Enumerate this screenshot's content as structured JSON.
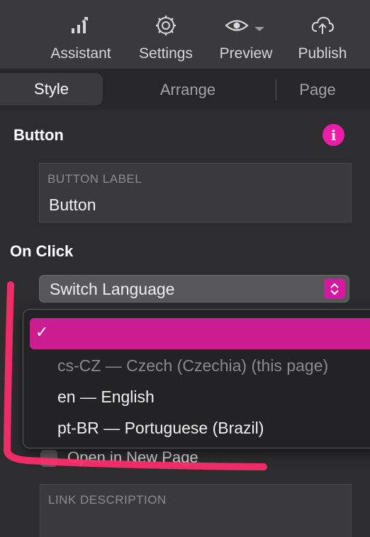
{
  "toolbar": {
    "assistant": {
      "label": "Assistant",
      "icon": "chart-bars-icon"
    },
    "settings": {
      "label": "Settings",
      "icon": "gear-icon"
    },
    "preview": {
      "label": "Preview",
      "icon": "eye-icon"
    },
    "publish": {
      "label": "Publish",
      "icon": "cloud-upload-icon"
    }
  },
  "tabs": {
    "style": "Style",
    "arrange": "Arrange",
    "page": "Page"
  },
  "inspector": {
    "section_title": "Button",
    "info_glyph": "i",
    "button_label_caption": "BUTTON LABEL",
    "button_label_value": "Button",
    "on_click_title": "On Click",
    "action_value": "Switch Language",
    "open_new_page_label": "Open in New Page",
    "link_description_caption": "LINK DESCRIPTION"
  },
  "dropdown": {
    "check_glyph": "✓",
    "options": [
      "",
      "cs-CZ — Czech (Czechia) (this page)",
      "en — English",
      "pt-BR — Portuguese (Brazil)"
    ],
    "selected_index": 0
  },
  "colors": {
    "accent": "#cc1c92",
    "annotation": "#ff2d6e",
    "panel": "#2d2d30",
    "toolbar": "#3a3a3d"
  }
}
